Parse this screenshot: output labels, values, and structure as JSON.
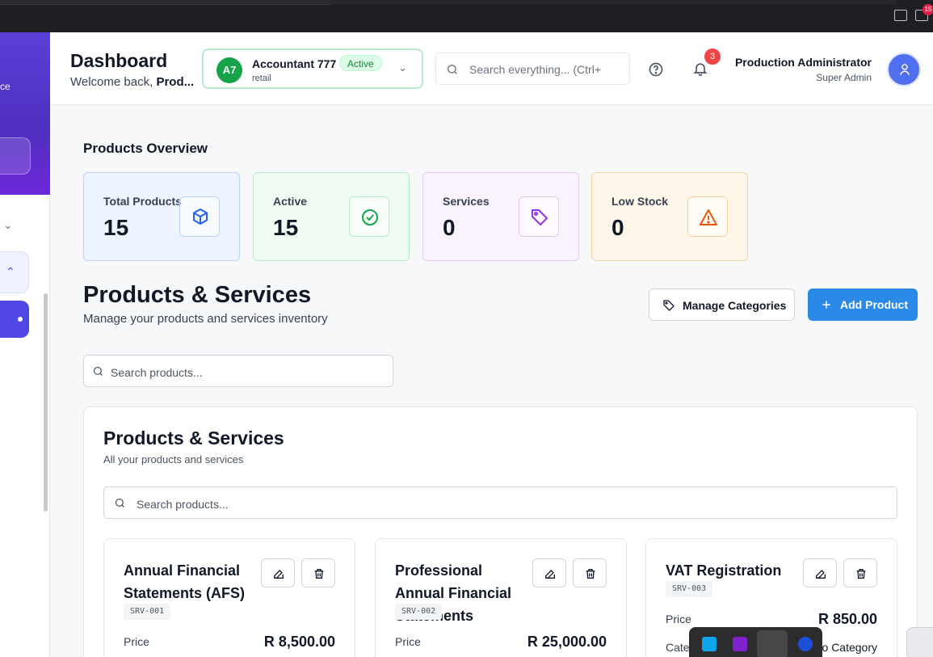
{
  "header": {
    "title": "Dashboard",
    "welcome_prefix": "Welcome back, ",
    "welcome_name": "Prod...",
    "company": {
      "initials": "A7",
      "name": "Accountant 777",
      "status": "Active",
      "type": "retail"
    },
    "search_placeholder": "Search everything... (Ctrl+",
    "notification_count": "3",
    "user_name": "Production Administrator",
    "user_role": "Super Admin"
  },
  "sidebar": {
    "brand_fragment": "ce"
  },
  "overview": {
    "title": "Products Overview",
    "stats": [
      {
        "label": "Total Products",
        "value": "15",
        "icon": "cube-icon",
        "color": "#2563eb"
      },
      {
        "label": "Active",
        "value": "15",
        "icon": "check-circle-icon",
        "color": "#16a34a"
      },
      {
        "label": "Services",
        "value": "0",
        "icon": "tag-icon",
        "color": "#9333ea"
      },
      {
        "label": "Low Stock",
        "value": "0",
        "icon": "warning-icon",
        "color": "#ea580c"
      }
    ]
  },
  "products": {
    "title": "Products & Services",
    "subtitle": "Manage your products and services inventory",
    "manage_categories_label": "Manage Categories",
    "add_product_label": "Add Product",
    "search_placeholder": "Search products..."
  },
  "panel": {
    "title": "Products & Services",
    "subtitle": "All your products and services",
    "search_placeholder": "Search products...",
    "cards": [
      {
        "name": "Annual Financial Statements (AFS)",
        "code": "SRV-001",
        "price_label": "Price",
        "price": "R 8,500.00"
      },
      {
        "name": "Professional Annual Financial Statements",
        "code": "SRV-002",
        "price_label": "Price",
        "price": "R 25,000.00"
      },
      {
        "name": "VAT Registration",
        "code": "SRV-003",
        "price_label": "Price",
        "price": "R 850.00",
        "category_label": "Cate",
        "category_value": "o Category"
      }
    ]
  },
  "os": {
    "tray_badge": "15"
  }
}
